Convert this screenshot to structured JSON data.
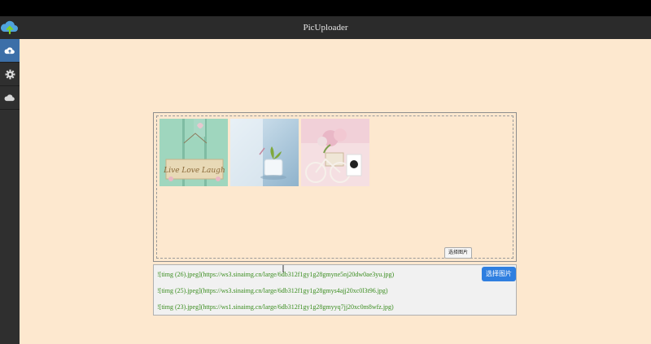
{
  "app": {
    "title": "PicUploader"
  },
  "sidebar": {
    "items": [
      {
        "icon": "cloud-upload-icon",
        "active": true
      },
      {
        "icon": "gear-icon",
        "active": false
      },
      {
        "icon": "cloud-icon",
        "active": false
      }
    ]
  },
  "upload": {
    "choose_small_label": "选择图片",
    "thumbnails": [
      {
        "name": "thumbnail-sign-door"
      },
      {
        "name": "thumbnail-plant-pot"
      },
      {
        "name": "thumbnail-flower-bicycle"
      }
    ]
  },
  "results": {
    "choose_button_label": "选择图片",
    "links": [
      "![timg (26).jpeg](https://ws3.sinaimg.cn/large/6db312f1gy1g28gmyne5nj20dw0ae3yu.jpg)",
      "![timg (25).jpeg](https://ws3.sinaimg.cn/large/6db312f1gy1g28gmys4ajj20xc0l3t96.jpg)",
      "![timg (23).jpeg](https://ws1.sinaimg.cn/large/6db312f1gy1g28gmyyq7jj20xc0m8wfz.jpg)"
    ]
  },
  "colors": {
    "background": "#fde8cf",
    "titlebar": "#2b2b2b",
    "sidebar": "#2f2f2f",
    "sidebar_active": "#3c6fa8",
    "link_text": "#3a8d1f",
    "primary_button": "#2f7fe0"
  }
}
